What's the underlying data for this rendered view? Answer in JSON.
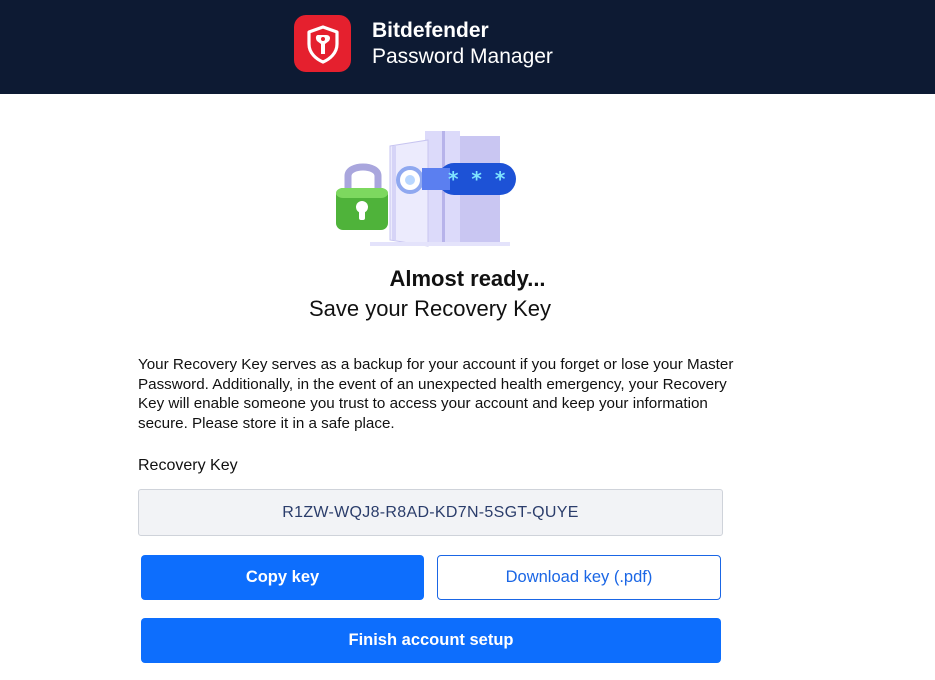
{
  "header": {
    "brand_name": "Bitdefender",
    "product_name": "Password Manager",
    "logo_icon": "bitdefender-shield-logo",
    "background_color": "#0d1a33",
    "logo_color": "#e5202e"
  },
  "illustration": {
    "icon": "padlock-vault-password-illustration",
    "password_mask": "* * *"
  },
  "main": {
    "title": "Almost ready...",
    "subtitle": "Save your Recovery Key",
    "description": "Your Recovery Key serves as a backup for your account if you forget or lose your Master Password. Additionally, in the event of an unexpected health emergency, your Recovery Key will enable someone you trust to access your account and keep your information secure. Please store it in a safe place.",
    "recovery_key_label": "Recovery Key",
    "recovery_key_value": "R1ZW-WQJ8-R8AD-KD7N-5SGT-QUYE"
  },
  "actions": {
    "copy_label": "Copy key",
    "download_label": "Download key (.pdf)",
    "finish_label": "Finish account setup",
    "primary_color": "#0d6efd"
  }
}
